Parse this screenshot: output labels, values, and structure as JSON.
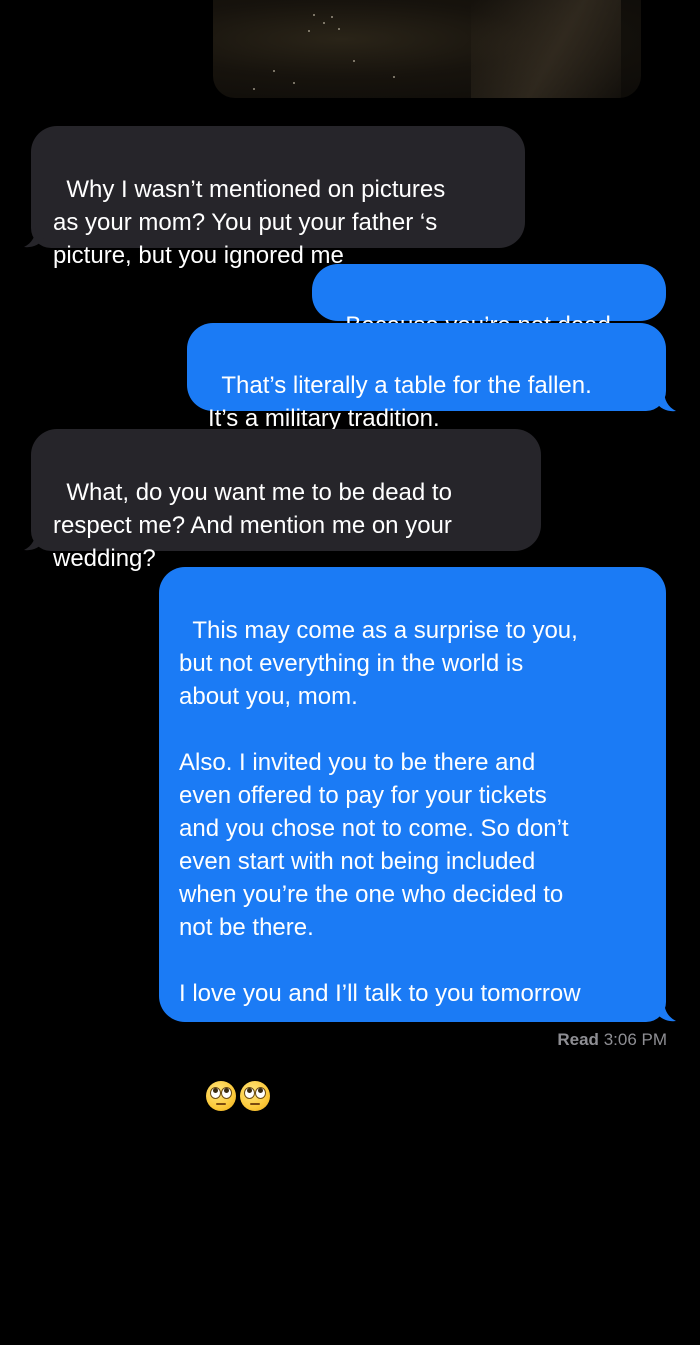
{
  "messages": [
    {
      "id": "m1",
      "direction": "received",
      "text": "Why I wasn’t mentioned on pictures\nas your mom? You put your father ‘s\npicture, but you ignored me"
    },
    {
      "id": "m2",
      "direction": "sent",
      "text": "Because you’re not dead"
    },
    {
      "id": "m3",
      "direction": "sent",
      "text": "That’s literally a table for the fallen.\nIt’s a military tradition."
    },
    {
      "id": "m4",
      "direction": "received",
      "text": "What, do you want me to be dead to\nrespect me? And mention me on your\nwedding?"
    },
    {
      "id": "m5",
      "direction": "sent",
      "text": "This may come as a surprise to you,\nbut not everything in the world is\nabout you, mom.\n\nAlso. I invited you to be there and\neven offered to pay for your tickets\nand you chose not to come. So don’t\neven start with not being included\nwhen you’re the one who decided to\nnot be there.\n\nI love you and I’ll talk to you tomorrow",
      "emoji": [
        "face-with-rolling-eyes",
        "face-with-rolling-eyes"
      ]
    }
  ],
  "status": {
    "read_label": "Read",
    "time": "3:06 PM"
  },
  "colors": {
    "background": "#000000",
    "received_bubble": "#26252a",
    "sent_bubble": "#1b7bf5",
    "status_text": "#8e8e93"
  },
  "icons": {
    "emoji": "face-with-rolling-eyes"
  }
}
